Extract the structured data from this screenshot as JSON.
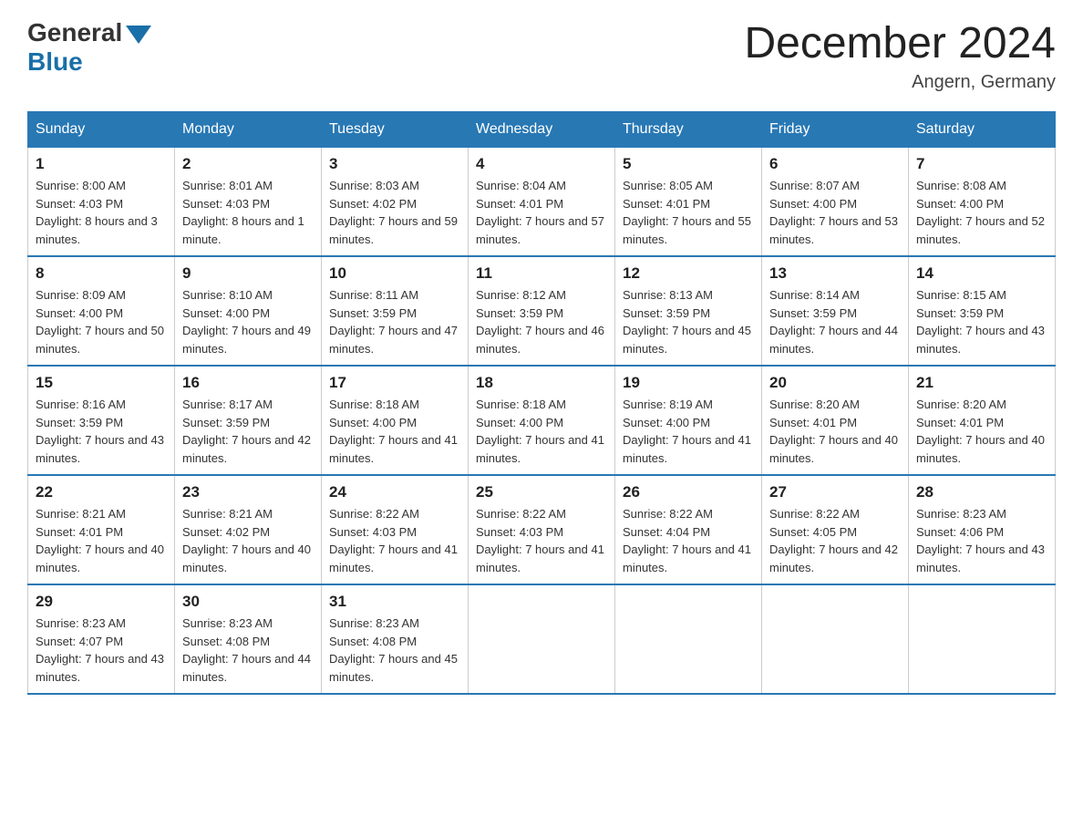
{
  "header": {
    "logo_general": "General",
    "logo_blue": "Blue",
    "month_title": "December 2024",
    "location": "Angern, Germany"
  },
  "weekdays": [
    "Sunday",
    "Monday",
    "Tuesday",
    "Wednesday",
    "Thursday",
    "Friday",
    "Saturday"
  ],
  "weeks": [
    [
      {
        "day": "1",
        "sunrise": "8:00 AM",
        "sunset": "4:03 PM",
        "daylight": "8 hours and 3 minutes."
      },
      {
        "day": "2",
        "sunrise": "8:01 AM",
        "sunset": "4:03 PM",
        "daylight": "8 hours and 1 minute."
      },
      {
        "day": "3",
        "sunrise": "8:03 AM",
        "sunset": "4:02 PM",
        "daylight": "7 hours and 59 minutes."
      },
      {
        "day": "4",
        "sunrise": "8:04 AM",
        "sunset": "4:01 PM",
        "daylight": "7 hours and 57 minutes."
      },
      {
        "day": "5",
        "sunrise": "8:05 AM",
        "sunset": "4:01 PM",
        "daylight": "7 hours and 55 minutes."
      },
      {
        "day": "6",
        "sunrise": "8:07 AM",
        "sunset": "4:00 PM",
        "daylight": "7 hours and 53 minutes."
      },
      {
        "day": "7",
        "sunrise": "8:08 AM",
        "sunset": "4:00 PM",
        "daylight": "7 hours and 52 minutes."
      }
    ],
    [
      {
        "day": "8",
        "sunrise": "8:09 AM",
        "sunset": "4:00 PM",
        "daylight": "7 hours and 50 minutes."
      },
      {
        "day": "9",
        "sunrise": "8:10 AM",
        "sunset": "4:00 PM",
        "daylight": "7 hours and 49 minutes."
      },
      {
        "day": "10",
        "sunrise": "8:11 AM",
        "sunset": "3:59 PM",
        "daylight": "7 hours and 47 minutes."
      },
      {
        "day": "11",
        "sunrise": "8:12 AM",
        "sunset": "3:59 PM",
        "daylight": "7 hours and 46 minutes."
      },
      {
        "day": "12",
        "sunrise": "8:13 AM",
        "sunset": "3:59 PM",
        "daylight": "7 hours and 45 minutes."
      },
      {
        "day": "13",
        "sunrise": "8:14 AM",
        "sunset": "3:59 PM",
        "daylight": "7 hours and 44 minutes."
      },
      {
        "day": "14",
        "sunrise": "8:15 AM",
        "sunset": "3:59 PM",
        "daylight": "7 hours and 43 minutes."
      }
    ],
    [
      {
        "day": "15",
        "sunrise": "8:16 AM",
        "sunset": "3:59 PM",
        "daylight": "7 hours and 43 minutes."
      },
      {
        "day": "16",
        "sunrise": "8:17 AM",
        "sunset": "3:59 PM",
        "daylight": "7 hours and 42 minutes."
      },
      {
        "day": "17",
        "sunrise": "8:18 AM",
        "sunset": "4:00 PM",
        "daylight": "7 hours and 41 minutes."
      },
      {
        "day": "18",
        "sunrise": "8:18 AM",
        "sunset": "4:00 PM",
        "daylight": "7 hours and 41 minutes."
      },
      {
        "day": "19",
        "sunrise": "8:19 AM",
        "sunset": "4:00 PM",
        "daylight": "7 hours and 41 minutes."
      },
      {
        "day": "20",
        "sunrise": "8:20 AM",
        "sunset": "4:01 PM",
        "daylight": "7 hours and 40 minutes."
      },
      {
        "day": "21",
        "sunrise": "8:20 AM",
        "sunset": "4:01 PM",
        "daylight": "7 hours and 40 minutes."
      }
    ],
    [
      {
        "day": "22",
        "sunrise": "8:21 AM",
        "sunset": "4:01 PM",
        "daylight": "7 hours and 40 minutes."
      },
      {
        "day": "23",
        "sunrise": "8:21 AM",
        "sunset": "4:02 PM",
        "daylight": "7 hours and 40 minutes."
      },
      {
        "day": "24",
        "sunrise": "8:22 AM",
        "sunset": "4:03 PM",
        "daylight": "7 hours and 41 minutes."
      },
      {
        "day": "25",
        "sunrise": "8:22 AM",
        "sunset": "4:03 PM",
        "daylight": "7 hours and 41 minutes."
      },
      {
        "day": "26",
        "sunrise": "8:22 AM",
        "sunset": "4:04 PM",
        "daylight": "7 hours and 41 minutes."
      },
      {
        "day": "27",
        "sunrise": "8:22 AM",
        "sunset": "4:05 PM",
        "daylight": "7 hours and 42 minutes."
      },
      {
        "day": "28",
        "sunrise": "8:23 AM",
        "sunset": "4:06 PM",
        "daylight": "7 hours and 43 minutes."
      }
    ],
    [
      {
        "day": "29",
        "sunrise": "8:23 AM",
        "sunset": "4:07 PM",
        "daylight": "7 hours and 43 minutes."
      },
      {
        "day": "30",
        "sunrise": "8:23 AM",
        "sunset": "4:08 PM",
        "daylight": "7 hours and 44 minutes."
      },
      {
        "day": "31",
        "sunrise": "8:23 AM",
        "sunset": "4:08 PM",
        "daylight": "7 hours and 45 minutes."
      },
      null,
      null,
      null,
      null
    ]
  ],
  "labels": {
    "sunrise_prefix": "Sunrise: ",
    "sunset_prefix": "Sunset: ",
    "daylight_prefix": "Daylight: "
  }
}
